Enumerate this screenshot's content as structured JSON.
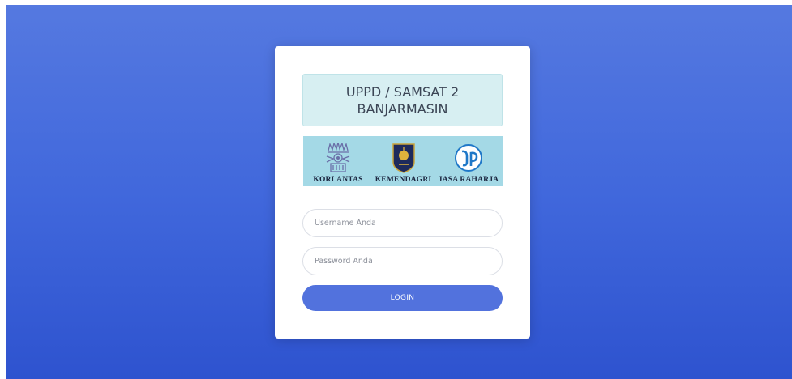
{
  "header": {
    "title_line1": "UPPD / SAMSAT 2",
    "title_line2": "BANJARMASIN"
  },
  "logos": [
    {
      "label": "KORLANTAS",
      "icon": "korlantas-emblem-icon"
    },
    {
      "label": "KEMENDAGRI",
      "icon": "kemendagri-emblem-icon"
    },
    {
      "label": "JASA RAHARJA",
      "icon": "jasa-raharja-emblem-icon"
    }
  ],
  "form": {
    "username_placeholder": "Username Anda",
    "password_placeholder": "Password Anda",
    "login_label": "LOGIN"
  },
  "colors": {
    "background_top": "#5579e0",
    "background_bottom": "#2e53cf",
    "title_box": "#d7eff2",
    "logo_strip": "#a4d9e6",
    "button": "#5272dd"
  }
}
